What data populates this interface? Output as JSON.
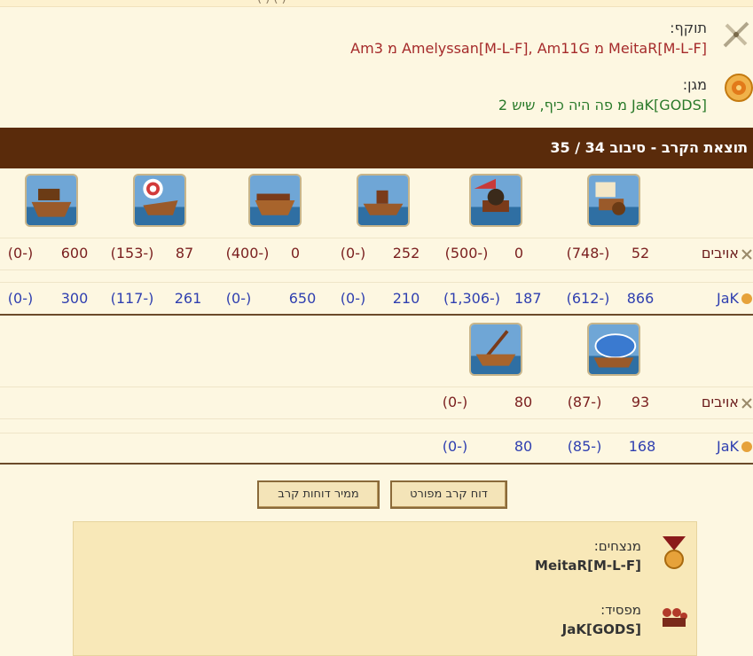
{
  "header": {
    "top_cut_text": "(  ) ( )"
  },
  "attacker": {
    "label": "תוקף:",
    "text": "MeitaR[M-L-F] מ Amelyssan[M-L-F], Am11G מ Am3"
  },
  "defender": {
    "label": "מגן:",
    "text": "JaK[GODS] מ פה היה כיף, שיש 2"
  },
  "result_bar": {
    "title": "תוצאת הקרב - סיבוב 34 / 35"
  },
  "rows": {
    "enemy_label": "אויבים",
    "mine_label": "JaK"
  },
  "block1": {
    "units": [
      "gunner",
      "mortar",
      "catapult-ship",
      "ram-ship",
      "ballista-ship",
      "crossbow-ship"
    ],
    "enemy": [
      {
        "value": "52",
        "loss": "(748-)"
      },
      {
        "value": "0",
        "loss": "(500-)"
      },
      {
        "value": "252",
        "loss": "(0-)"
      },
      {
        "value": "0",
        "loss": "(400-)"
      },
      {
        "value": "87",
        "loss": "(153-)"
      },
      {
        "value": "600",
        "loss": "(0-)"
      }
    ],
    "mine": [
      {
        "value": "866",
        "loss": "(612-)"
      },
      {
        "value": "187",
        "loss": "(1,306-)"
      },
      {
        "value": "210",
        "loss": "(0-)"
      },
      {
        "value": "650",
        "loss": "(0-)"
      },
      {
        "value": "261",
        "loss": "(117-)"
      },
      {
        "value": "300",
        "loss": "(0-)"
      }
    ]
  },
  "block2": {
    "units": [
      "paddle-ship",
      "crane-ship"
    ],
    "enemy": [
      {
        "value": "93",
        "loss": "(87-)"
      },
      {
        "value": "80",
        "loss": "(0-)"
      }
    ],
    "mine": [
      {
        "value": "168",
        "loss": "(85-)"
      },
      {
        "value": "80",
        "loss": "(0-)"
      }
    ]
  },
  "buttons": {
    "detailed": "דוח קרב מפורט",
    "archive": "ממיר דוחות קרב"
  },
  "summary": {
    "winners_label": "מנצחים:",
    "winners_value": "MeitaR[M-L-F]",
    "losers_label": "מפסיד:",
    "losers_value": "JaK[GODS]"
  },
  "colors": {
    "accent_brown": "#5a2b0b",
    "enemy_text": "#7a1f1f",
    "mine_text": "#2f3fb0",
    "attacker_text": "#a52a2a",
    "defender_text": "#2a7a2a"
  }
}
